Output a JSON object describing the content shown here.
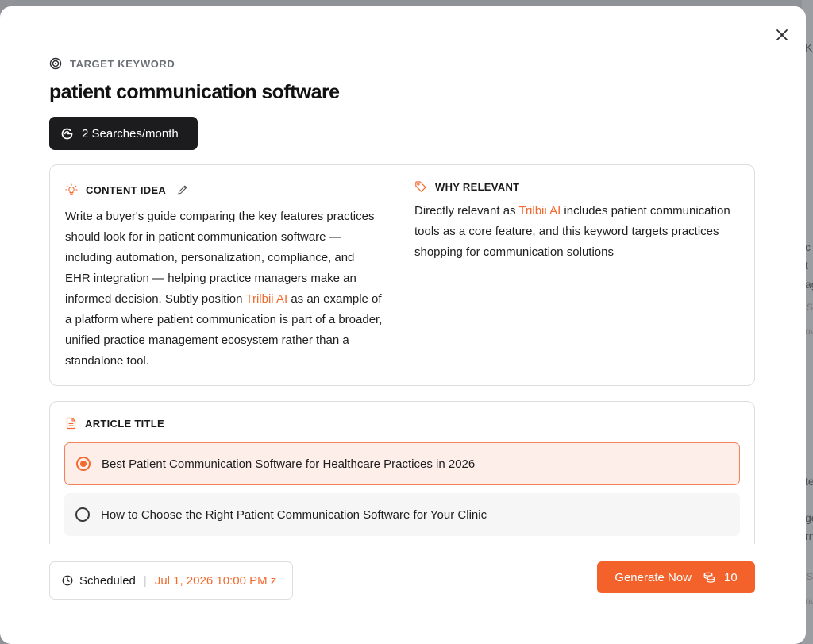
{
  "background": {
    "fragments": [
      "K",
      "c",
      "t",
      "ag",
      "S",
      "ov",
      "te",
      "ge",
      "rn",
      "S",
      "ov"
    ]
  },
  "modal": {
    "target_keyword_label": "TARGET KEYWORD",
    "keyword": "patient communication software",
    "searches": "2 Searches/month",
    "content_idea": {
      "label": "CONTENT IDEA",
      "text_before": "Write a buyer's guide comparing the key features practices should look for in patient communication software — including automation, personalization, compliance, and EHR integration — helping practice managers make an informed decision. Subtly position ",
      "brand": "Trilbii AI",
      "text_after": " as an example of a platform where patient communication is part of a broader, unified practice management ecosystem rather than a standalone tool."
    },
    "why_relevant": {
      "label": "WHY RELEVANT",
      "text_before": "Directly relevant as ",
      "brand": "Trilbii AI",
      "text_after": " includes patient communication tools as a core feature, and this keyword targets practices shopping for communication solutions"
    },
    "article_title": {
      "label": "ARTICLE TITLE",
      "options": [
        {
          "label": "Best Patient Communication Software for Healthcare Practices in 2026",
          "selected": true
        },
        {
          "label": "How to Choose the Right Patient Communication Software for Your Clinic",
          "selected": false
        }
      ]
    },
    "schedule": {
      "label": "Scheduled",
      "datetime": "Jul 1, 2026 10:00 PM z"
    },
    "generate": {
      "label": "Generate Now",
      "credits": "10"
    }
  },
  "colors": {
    "accent": "#f26a2e",
    "selected_bg": "#fdeee9",
    "pill_bg": "#1c1c1e"
  }
}
